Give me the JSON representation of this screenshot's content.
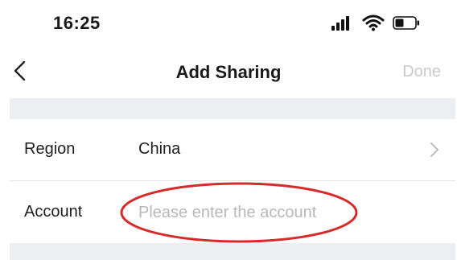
{
  "status_bar": {
    "time": "16:25",
    "signal_icon": "cellular-signal-icon",
    "wifi_icon": "wifi-icon",
    "battery_icon": "battery-icon"
  },
  "nav": {
    "back_icon": "chevron-left-icon",
    "title": "Add Sharing",
    "done_label": "Done"
  },
  "form": {
    "region": {
      "label": "Region",
      "value": "China",
      "chevron_icon": "chevron-right-icon"
    },
    "account": {
      "label": "Account",
      "placeholder": "Please enter the account",
      "value": ""
    }
  },
  "annotation": {
    "shape": "ellipse",
    "color": "#d62b2b"
  },
  "colors": {
    "background": "#ffffff",
    "section_gap": "#eceef1",
    "done_disabled": "#c9c9c9",
    "placeholder": "#b8b8b8"
  }
}
